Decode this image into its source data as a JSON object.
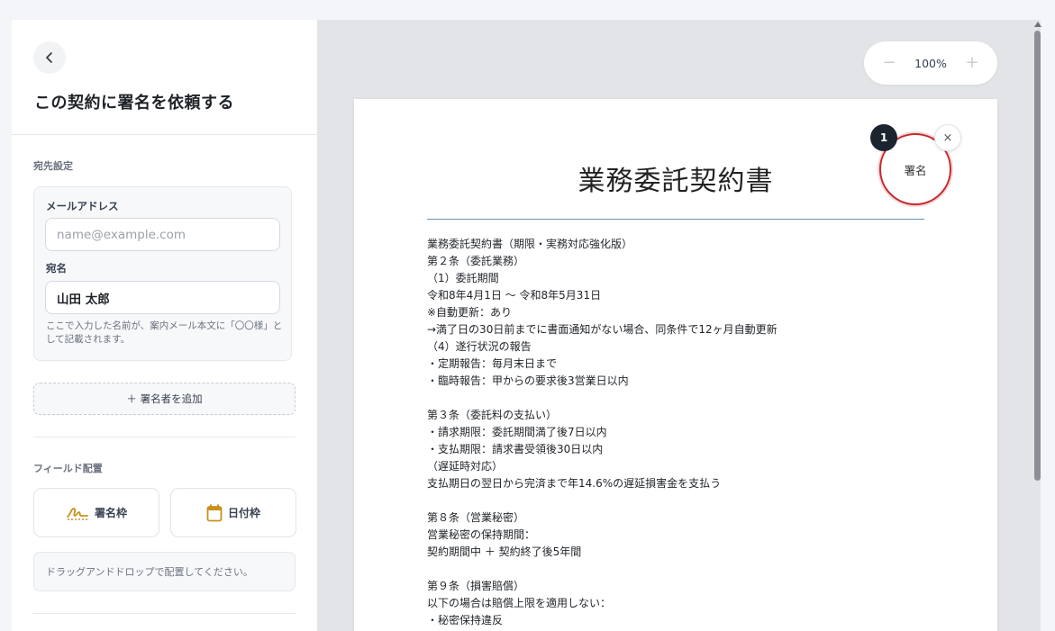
{
  "sidebar": {
    "title": "この契約に署名を依頼する",
    "recipient_section_label": "宛先設定",
    "email_label": "メールアドレス",
    "email_placeholder": "name@example.com",
    "email_value": "",
    "name_label": "宛名",
    "name_value": "山田 太郎",
    "name_hint": "ここで入力した名前が、案内メール本文に「〇〇様」として記載されます。",
    "add_signer_label": "＋ 署名者を追加",
    "field_section_label": "フィールド配置",
    "signature_field_label": "署名枠",
    "date_field_label": "日付枠",
    "dnd_hint": "ドラッグアンドドロップで配置してください。"
  },
  "zoom": {
    "minus": "−",
    "value": "100%",
    "plus": "+"
  },
  "document": {
    "title": "業務委託契約書",
    "lines": [
      "業務委託契約書（期限・実務対応強化版）",
      "第２条（委託業務）",
      "（1）委託期間",
      "令和8年4月1日 〜 令和8年5月31日",
      "※自動更新：あり",
      "→満了日の30日前までに書面通知がない場合、同条件で12ヶ月自動更新",
      "（4）遂行状況の報告",
      "・定期報告：毎月末日まで",
      "・臨時報告：甲からの要求後3営業日以内",
      "",
      "第３条（委託料の支払い）",
      "・請求期限：委託期間満了後7日以内",
      "・支払期限：請求書受領後30日以内",
      "（遅延時対応）",
      "支払期日の翌日から完済まで年14.6%の遅延損害金を支払う",
      "",
      "第８条（営業秘密）",
      "営業秘密の保持期間：",
      "契約期間中 ＋ 契約終了後5年間",
      "",
      "第９条（損害賠償）",
      "以下の場合は賠償上限を適用しない：",
      "・秘密保持違反"
    ]
  },
  "signature_field": {
    "badge": "1",
    "label": "署名",
    "close": "×"
  },
  "colors": {
    "signature_ring": "#c7272d",
    "badge_bg": "#1c2430",
    "rule": "#6b8fae",
    "date_icon": "#c8911c"
  }
}
